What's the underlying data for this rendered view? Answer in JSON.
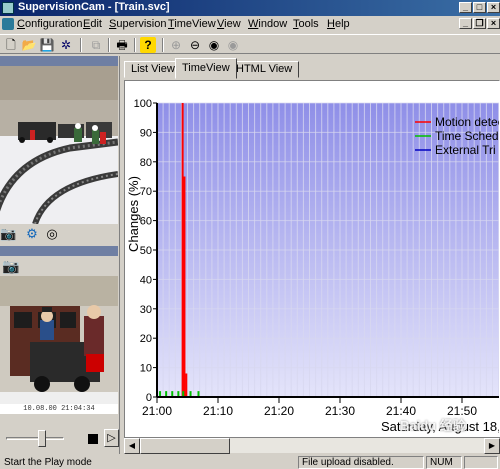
{
  "window": {
    "title": "SupervisionCam - [Train.svc]"
  },
  "menu": [
    {
      "label": "Configuration",
      "accel": "C",
      "rest": "onfiguration"
    },
    {
      "label": "Edit",
      "accel": "E",
      "rest": "dit"
    },
    {
      "label": "Supervision",
      "accel": "S",
      "rest": "upervision"
    },
    {
      "label": "TimeView",
      "accel": "T",
      "rest": "imeView"
    },
    {
      "label": "View",
      "accel": "V",
      "rest": "iew"
    },
    {
      "label": "Window",
      "accel": "W",
      "rest": "indow"
    },
    {
      "label": "Tools",
      "accel": "T",
      "rest": "ools"
    },
    {
      "label": "Help",
      "accel": "H",
      "rest": "elp"
    }
  ],
  "tabs": [
    "List View",
    "TimeView",
    "HTML View"
  ],
  "active_tab": "TimeView",
  "cameras": [
    {
      "timestamp": ""
    },
    {
      "timestamp": "10.08.00 21:04:34"
    }
  ],
  "status": {
    "message": "Start the Play mode",
    "upload": "File upload disabled.",
    "num": "NUM"
  },
  "watermark": "Baidu 经验",
  "chart_data": {
    "type": "bar",
    "ylabel": "Changes (%)",
    "xlabel": "Saturday, August 18,",
    "ylim": [
      0,
      100
    ],
    "yticks": [
      0,
      10,
      20,
      30,
      40,
      50,
      60,
      70,
      80,
      90,
      100
    ],
    "xticks": [
      "21:00",
      "21:10",
      "21:20",
      "21:30",
      "21:40",
      "21:50"
    ],
    "x_unit": "minutes after 21:00",
    "xlim": [
      0,
      55
    ],
    "legend": [
      "Motion detec",
      "Time Schedu",
      "External Tri"
    ],
    "legend_position": "top-right",
    "grid": true,
    "series": [
      {
        "name": "Motion detec",
        "color": "#ff0000",
        "points": [
          {
            "x": 4.2,
            "y": 100
          },
          {
            "x": 4.5,
            "y": 75
          },
          {
            "x": 4.8,
            "y": 8
          }
        ]
      },
      {
        "name": "Time Schedu",
        "color": "#00c000",
        "points": [
          {
            "x": 0.5,
            "y": 2
          },
          {
            "x": 1.5,
            "y": 2
          },
          {
            "x": 2.5,
            "y": 2
          },
          {
            "x": 3.5,
            "y": 2
          },
          {
            "x": 4.3,
            "y": 2
          },
          {
            "x": 5.5,
            "y": 2
          },
          {
            "x": 6.8,
            "y": 2
          }
        ]
      },
      {
        "name": "External Tri",
        "color": "#0000c0",
        "points": []
      }
    ],
    "colors": {
      "bg_top": "#8f8fe8",
      "bg_bottom": "#e4e4fa",
      "grid": "#d8d8f0"
    }
  }
}
